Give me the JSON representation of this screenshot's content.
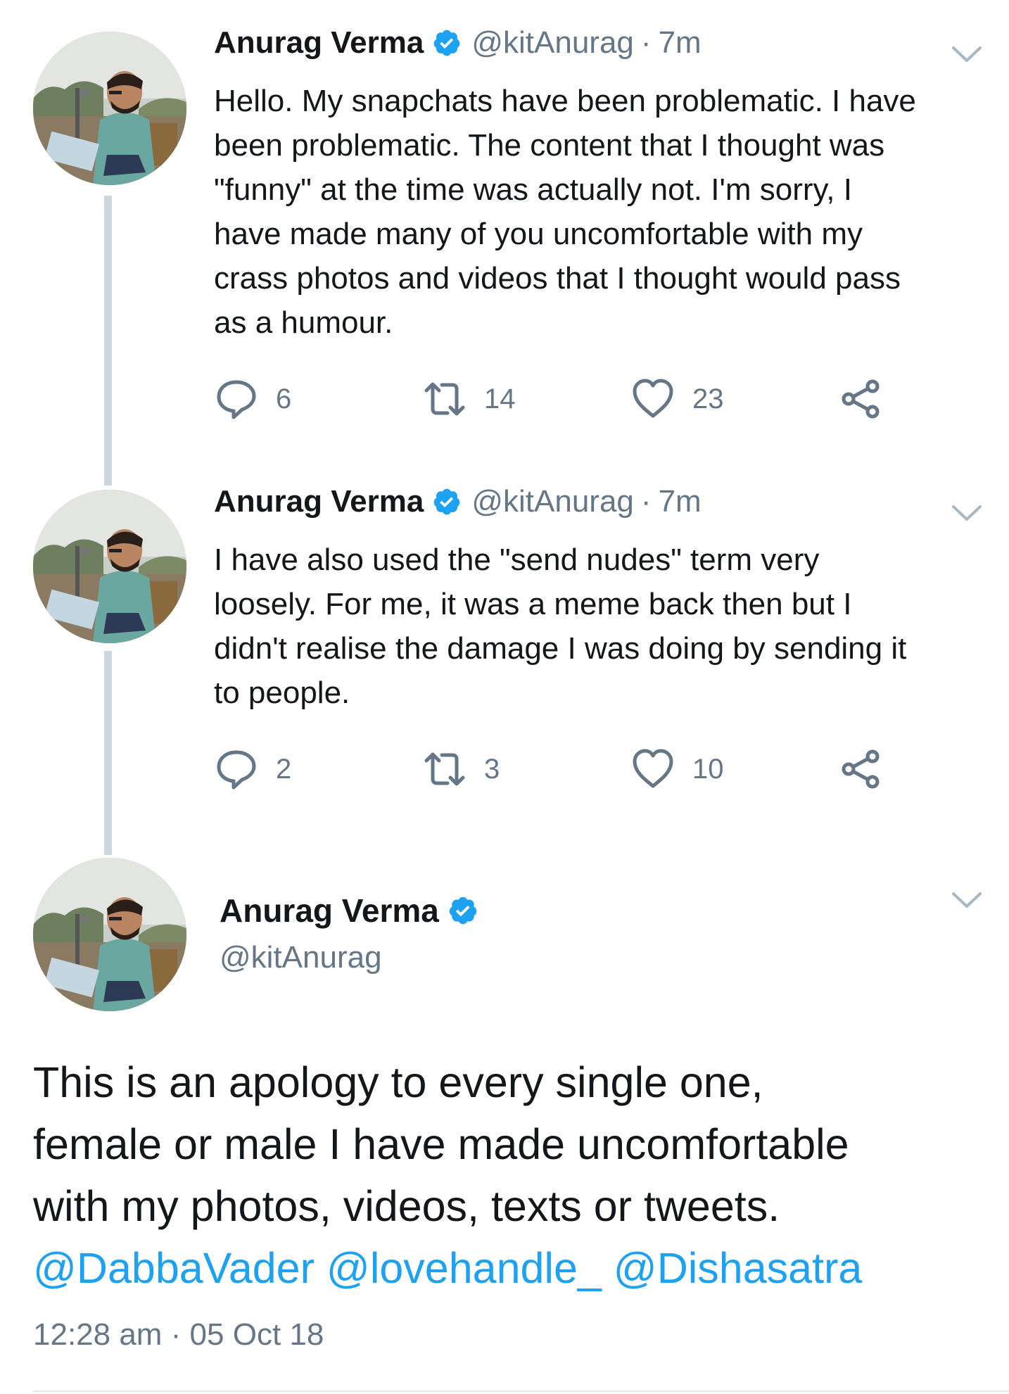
{
  "colors": {
    "link": "#1da1f2",
    "muted": "#657786",
    "text": "#14171a",
    "thread_line": "#ccd6dd",
    "verified": "#1da1f2"
  },
  "tweets": [
    {
      "name": "Anurag Verma",
      "handle": "@kitAnurag",
      "dot": "·",
      "time": "7m",
      "lines": [
        "Hello. My snapchats have been problematic. I have",
        "been problematic. The content that I thought was",
        "\"funny\" at the time was actually not. I'm sorry, I",
        "have made many of you uncomfortable with my",
        "crass photos and videos that I thought would pass",
        "as a humour."
      ],
      "replies": "6",
      "retweets": "14",
      "likes": "23"
    },
    {
      "name": "Anurag Verma",
      "handle": "@kitAnurag",
      "dot": "·",
      "time": "7m",
      "lines": [
        "I have also used the \"send nudes\" term very",
        "loosely. For me, it was a meme back then but I",
        "didn't realise the damage I was doing by sending it",
        "to people."
      ],
      "replies": "2",
      "retweets": "3",
      "likes": "10"
    }
  ],
  "main_tweet": {
    "name": "Anurag Verma",
    "handle": "@kitAnurag",
    "lines": [
      "This is an apology to every single one,",
      "female or male I have made uncomfortable",
      "with my photos, videos, texts or tweets."
    ],
    "mentions": [
      "@DabbaVader",
      "@lovehandle_",
      "@Dishasatra"
    ],
    "timestamp": "12:28 am · 05 Oct 18"
  }
}
